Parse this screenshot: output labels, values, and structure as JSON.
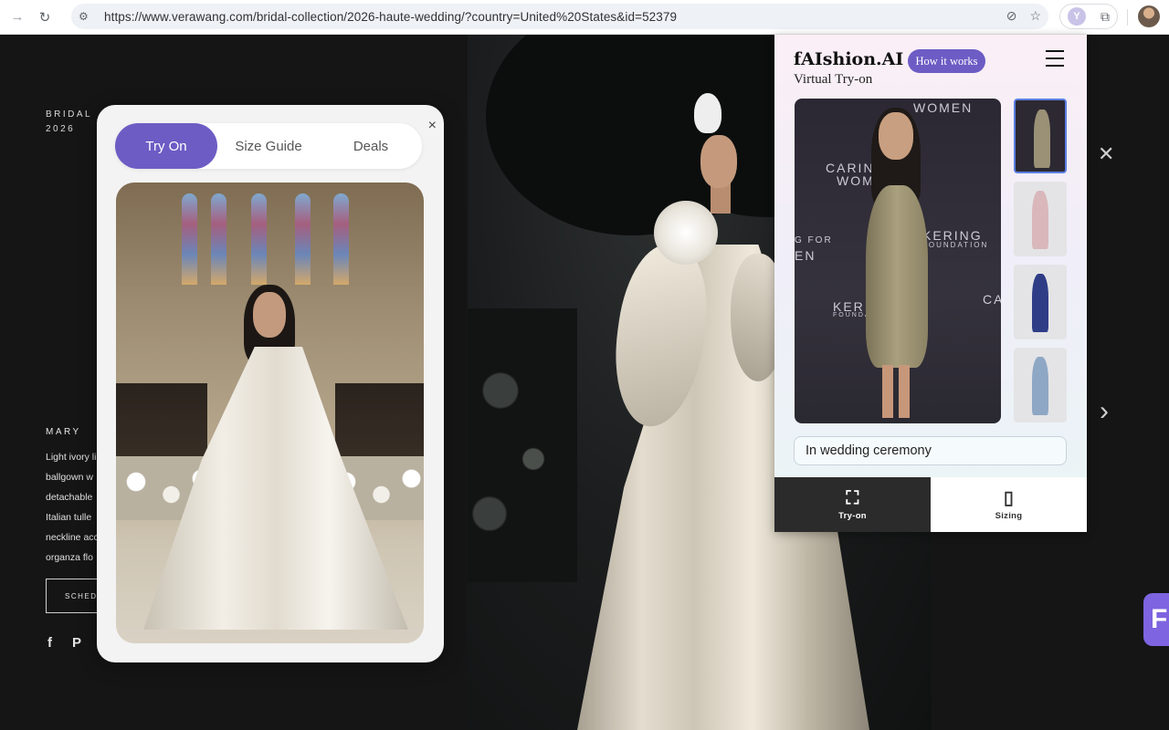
{
  "browser": {
    "url": "https://www.verawang.com/bridal-collection/2026-haute-wedding/?country=United%20States&id=52379",
    "icons": [
      "back-arrow-icon",
      "reload-icon",
      "site-settings-icon",
      "shield-off-icon",
      "bookmark-star-icon",
      "extension-icon",
      "puzzle-icon",
      "profile-avatar"
    ],
    "extension_letter": "Y"
  },
  "page": {
    "collection_line1": "BRIDAL",
    "collection_line2": "2026",
    "dress_name": "MARY",
    "description_lines": [
      "Light ivory li",
      "ballgown w",
      "detachable",
      "Italian tulle",
      "neckline acc",
      "organza flo"
    ],
    "schedule_label": "SCHEDU",
    "social_icons": [
      "facebook-icon",
      "pinterest-icon",
      "instagram-icon"
    ],
    "fab_label": "F"
  },
  "tryon_card": {
    "tabs": [
      {
        "label": "Try On",
        "active": true
      },
      {
        "label": "Size Guide",
        "active": false
      },
      {
        "label": "Deals",
        "active": false
      }
    ],
    "close_label": "×"
  },
  "ai_panel": {
    "title": "fAIshion.AI",
    "subtitle": "Virtual Try-on",
    "how_button": "How it works",
    "backdrop_texts": [
      "WOMEN",
      "CARING",
      "WOM",
      "KERING",
      "FOUNDATION",
      "G FOR",
      "EN",
      "KER",
      "FOUNDA",
      "CA"
    ],
    "prompt_value": "In wedding ceremony",
    "bottom_tabs": [
      {
        "label": "Try-on",
        "icon": "person-scan-icon",
        "active": true
      },
      {
        "label": "Sizing",
        "icon": "garment-icon",
        "active": false
      }
    ]
  },
  "colors": {
    "accent": "#6d5cc4",
    "page_bg": "#151515",
    "fab": "#7e64e0"
  }
}
